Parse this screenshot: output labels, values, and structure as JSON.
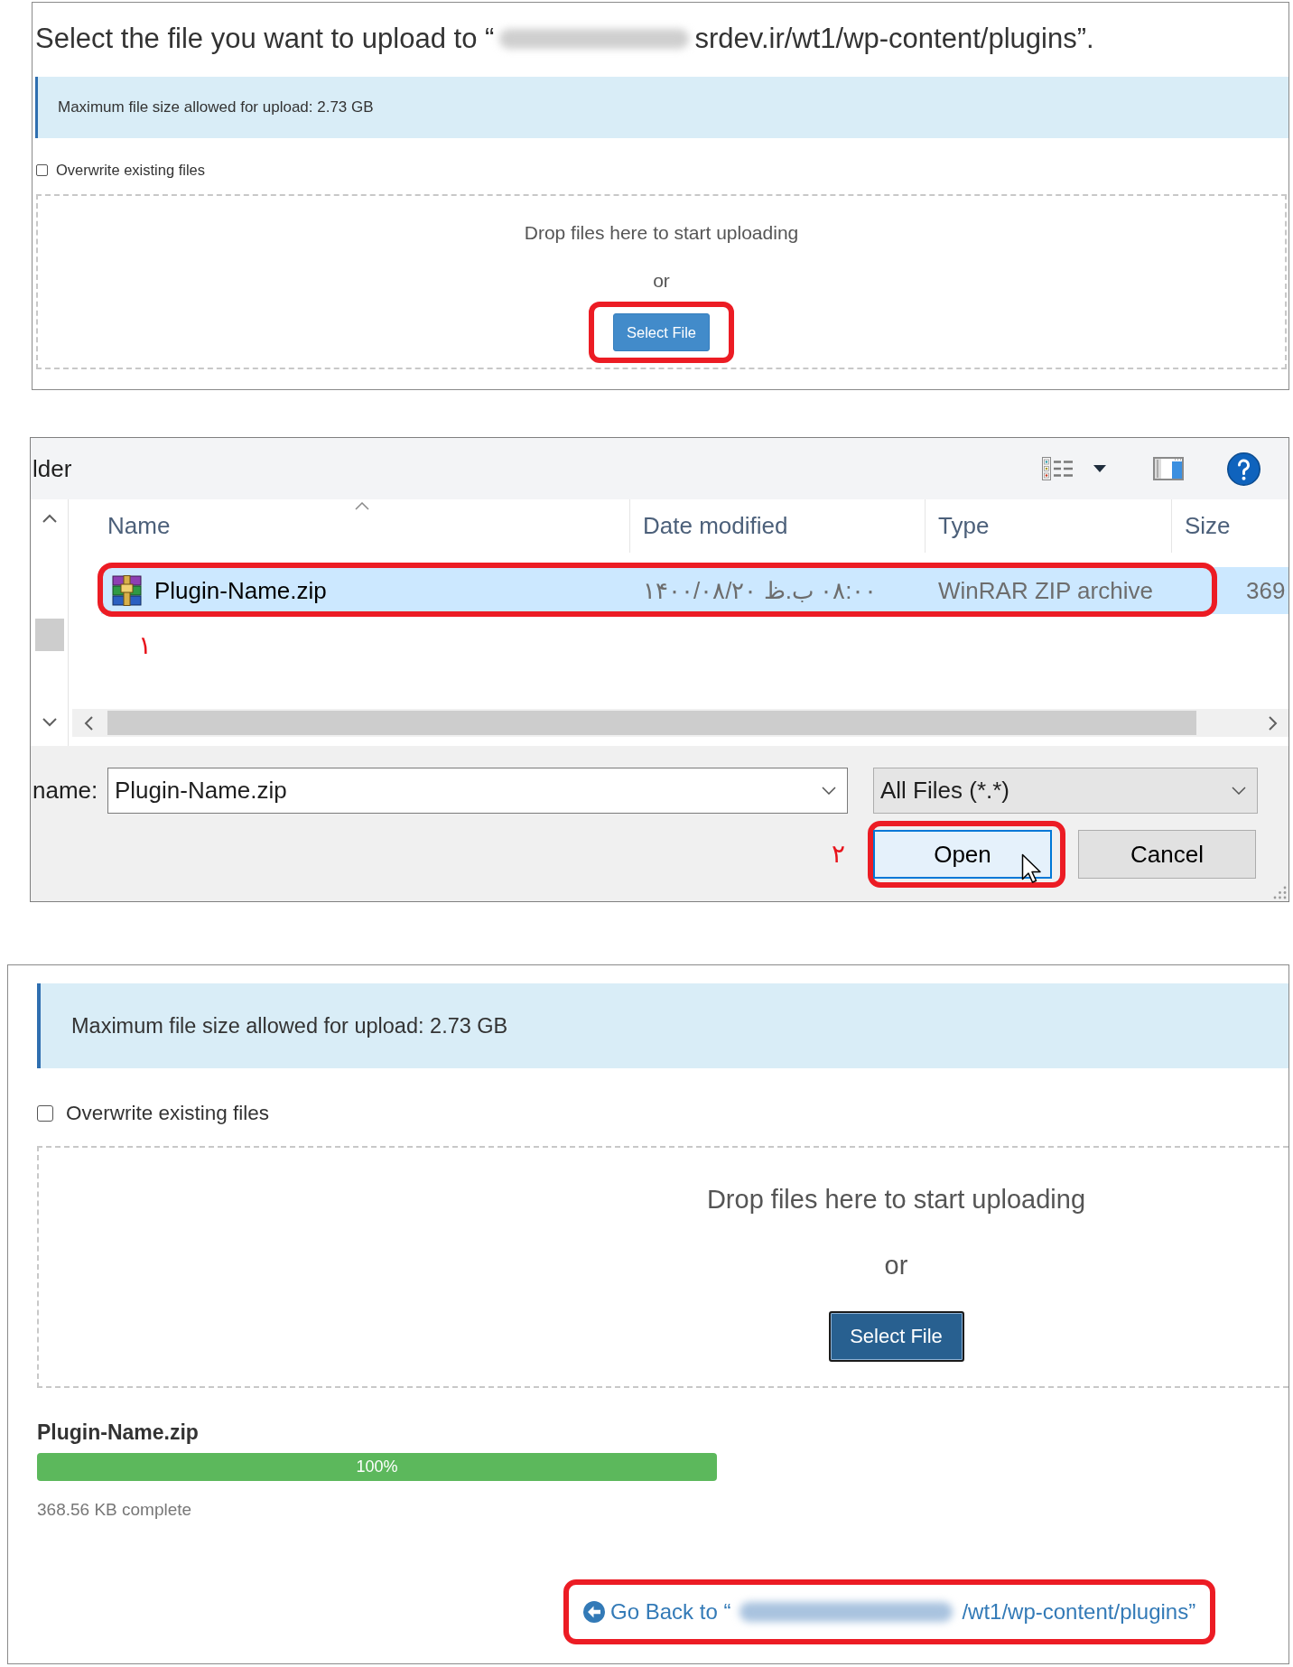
{
  "upload_panel": {
    "title_prefix": "Select the file you want to upload to “",
    "title_suffix": "srdev.ir/wt1/wp-content/plugins”.",
    "notice": "Maximum file size allowed for upload: 2.73 GB",
    "overwrite": {
      "label": "Overwrite existing files",
      "checked": false
    },
    "dropzone": {
      "text": "Drop files here to start uploading",
      "separator": "or",
      "button": {
        "label": "Select File",
        "focused": false,
        "highlighted": true
      }
    }
  },
  "file_dialog": {
    "location": "lder",
    "columns": [
      {
        "label": "Name",
        "sorted": true
      },
      {
        "label": "Date modified",
        "sorted": false
      },
      {
        "label": "Type",
        "sorted": false
      },
      {
        "label": "Size",
        "sorted": false
      }
    ],
    "files": [
      {
        "name": "Plugin-Name.zip",
        "date_modified": "۱۴۰۰/۰۸/۲۰ ب.ظ‎ ۰۸:۰۰",
        "type": "WinRAR ZIP archive",
        "size": "369",
        "selected": true,
        "highlighted": true,
        "step": "۱"
      }
    ],
    "file_name": {
      "label": "name:",
      "value": "Plugin-Name.zip"
    },
    "file_type": {
      "value": "All Files (*.*)"
    },
    "buttons": [
      {
        "label": "Open",
        "focused": true,
        "highlighted": true,
        "step": "۲"
      },
      {
        "label": "Cancel",
        "focused": false,
        "highlighted": false
      }
    ]
  },
  "progress_panel": {
    "notice": "Maximum file size allowed for upload: 2.73 GB",
    "overwrite": {
      "label": "Overwrite existing files",
      "checked": false
    },
    "dropzone": {
      "text": "Drop files here to start uploading",
      "separator": "or",
      "button": {
        "label": "Select File",
        "focused": true,
        "highlighted": false
      }
    },
    "upload": {
      "file_name": "Plugin-Name.zip",
      "level": 1,
      "percent": "100%",
      "status": "368.56 KB complete"
    },
    "back_link": {
      "prefix": "Go Back to “",
      "suffix": "/wt1/wp-content/plugins”",
      "highlighted": true
    }
  }
}
